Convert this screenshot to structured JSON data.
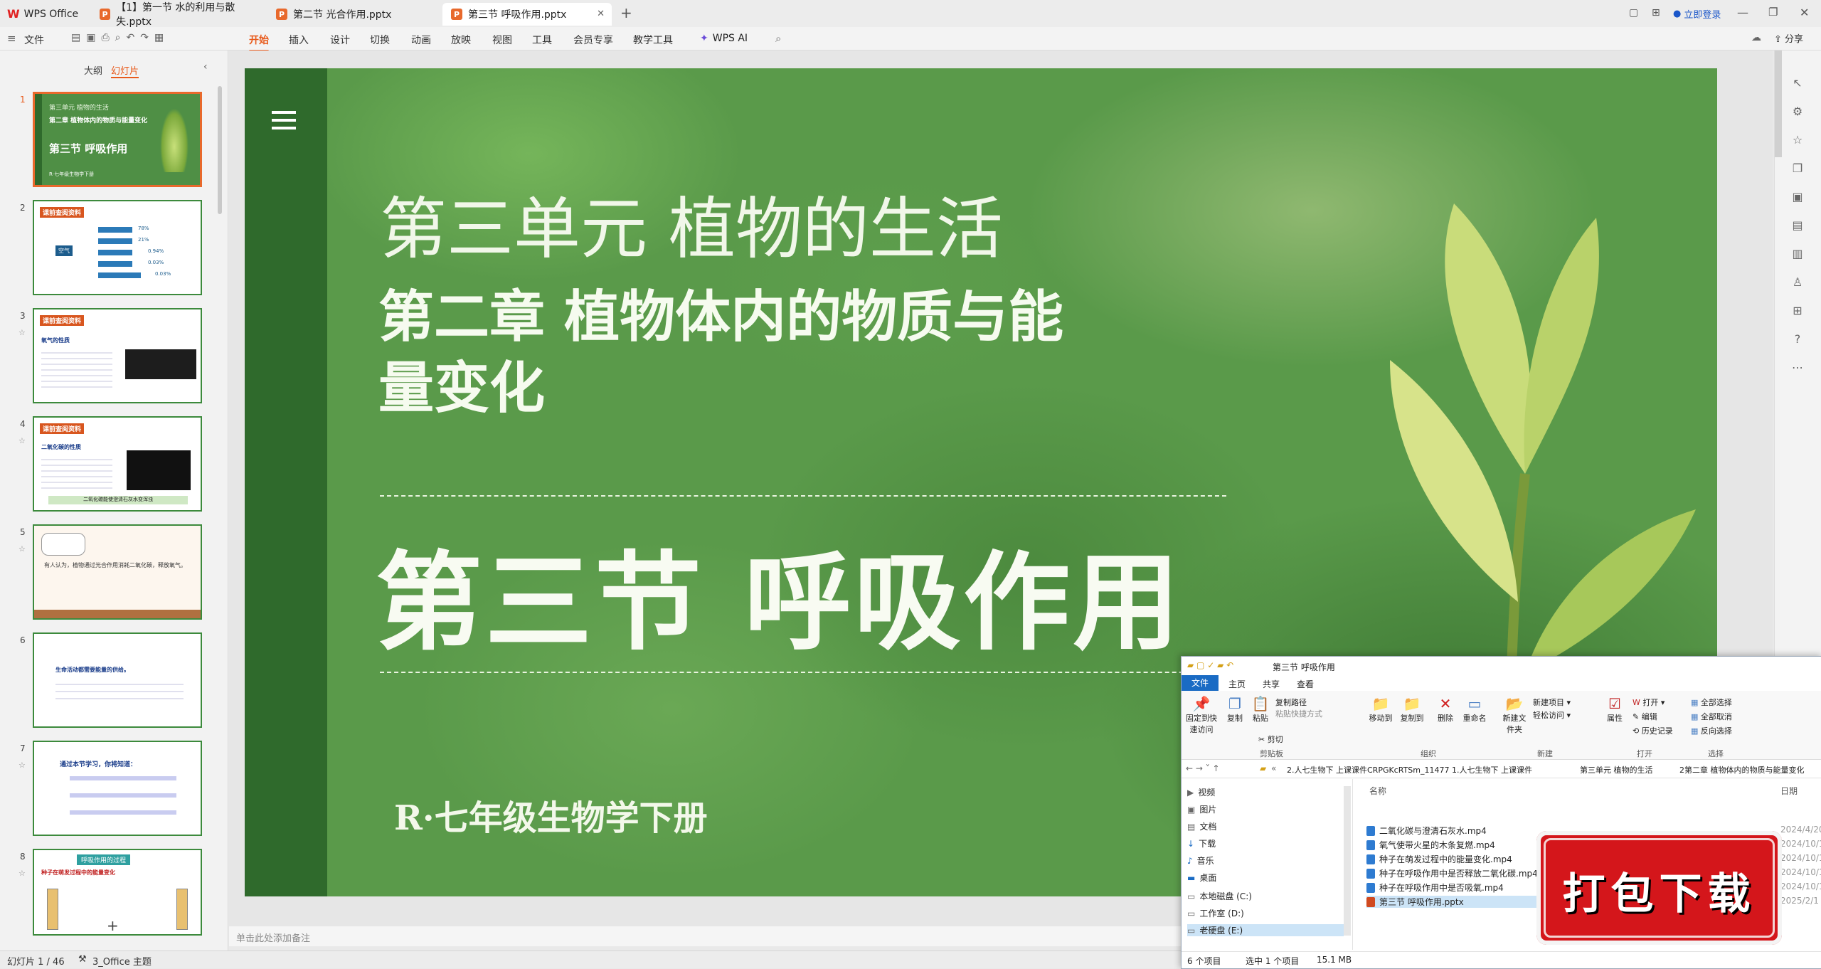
{
  "titlebar": {
    "app": "WPS Office",
    "tabs": [
      {
        "label": "【1】第一节 水的利用与散失.pptx"
      },
      {
        "label": "第二节 光合作用.pptx"
      },
      {
        "label": "第三节 呼吸作用.pptx"
      }
    ],
    "login": "立即登录"
  },
  "menubar": {
    "file": "文件",
    "items": [
      "开始",
      "插入",
      "设计",
      "切换",
      "动画",
      "放映",
      "视图",
      "工具",
      "会员专享",
      "教学工具"
    ],
    "ai": "WPS AI",
    "share": "分享"
  },
  "leftpanel": {
    "tabs": [
      "大纲",
      "幻灯片"
    ],
    "thumbs": [
      {
        "num": "1",
        "title": "第三节 呼吸作用",
        "sub": "第三单元 植物的生活",
        "line2": "第二章 植物体内的物质与能量变化",
        "foot": "R·七年级生物学下册"
      },
      {
        "num": "2",
        "title": "课前查阅资料",
        "sub": "空气",
        "pcts": [
          "78%",
          "21%",
          "0.94%",
          "0.03%",
          "0.03%"
        ]
      },
      {
        "num": "3",
        "title": "课前查阅资料",
        "sub": "氧气的性质"
      },
      {
        "num": "4",
        "title": "课前查阅资料",
        "sub": "二氧化碳的性质",
        "foot": "二氧化碳能使澄清石灰水变浑浊"
      },
      {
        "num": "5",
        "title": "",
        "sub": "有人认为，植物通过光合作用消耗二氧化碳，释放氧气。"
      },
      {
        "num": "6",
        "title": "",
        "sub": "生命活动都需要能量的供给。"
      },
      {
        "num": "7",
        "title": "",
        "sub": "通过本节学习，你将知道："
      },
      {
        "num": "8",
        "title": "呼吸作用的过程",
        "sub": "种子在萌发过程中的能量变化"
      }
    ],
    "add": "+"
  },
  "slide": {
    "unit": "第三单元 植物的生活",
    "chapter_l1": "第二章 植物体内的物质与能",
    "chapter_l2": "量变化",
    "section": "第三节 呼吸作用",
    "book": "R·七年级生物学下册",
    "menu_icon": "menu-icon"
  },
  "notes": {
    "placeholder": "单击此处添加备注"
  },
  "status": {
    "slide": "幻灯片 1 / 46",
    "theme": "3_Office 主题"
  },
  "explorer": {
    "title": "第三节 呼吸作用",
    "ribbon_tabs": [
      "文件",
      "主页",
      "共享",
      "查看"
    ],
    "groups": [
      "剪贴板",
      "组织",
      "新建",
      "打开",
      "选择"
    ],
    "buttons": {
      "pin": "固定到快速访问",
      "copy": "复制",
      "paste": "粘贴",
      "copypath": "复制路径",
      "pasteshortcut": "粘贴快捷方式",
      "cut": "剪切",
      "moveto": "移动到",
      "copyto": "复制到",
      "delete": "删除",
      "rename": "重命名",
      "newfolder": "新建文件夹",
      "newitem": "新建项目",
      "easyaccess": "轻松访问",
      "props": "属性",
      "open": "打开",
      "edit": "编辑",
      "history": "历史记录",
      "selectall": "全部选择",
      "selectnone": "全部取消",
      "invert": "反向选择"
    },
    "breadcrumb": [
      "2.人七生物下 上课课件CRPGKcRTSm_11477",
      "1.人七生物下 上课课件",
      "第三单元 植物的生活",
      "2第二章 植物体内的物质与能量变化"
    ],
    "nav": [
      "视频",
      "图片",
      "文档",
      "下载",
      "音乐",
      "桌面",
      "本地磁盘 (C:)",
      "工作室 (D:)",
      "老硬盘 (E:)"
    ],
    "col_name": "名称",
    "col_date": "日期",
    "files": [
      {
        "name": "二氧化碳与澄清石灰水.mp4",
        "date": "2024/4/20"
      },
      {
        "name": "氧气使带火星的木条复燃.mp4",
        "date": "2024/10/1"
      },
      {
        "name": "种子在萌发过程中的能量变化.mp4",
        "date": "2024/10/1"
      },
      {
        "name": "种子在呼吸作用中是否释放二氧化碳.mp4",
        "date": "2024/10/1"
      },
      {
        "name": "种子在呼吸作用中是否吸氧.mp4",
        "date": "2024/10/1"
      },
      {
        "name": "第三节 呼吸作用.pptx",
        "date": "2025/2/1"
      }
    ],
    "status_count": "6 个项目",
    "status_sel": "选中 1 个项目",
    "status_size": "15.1 MB"
  },
  "download_badge": "打包下载"
}
